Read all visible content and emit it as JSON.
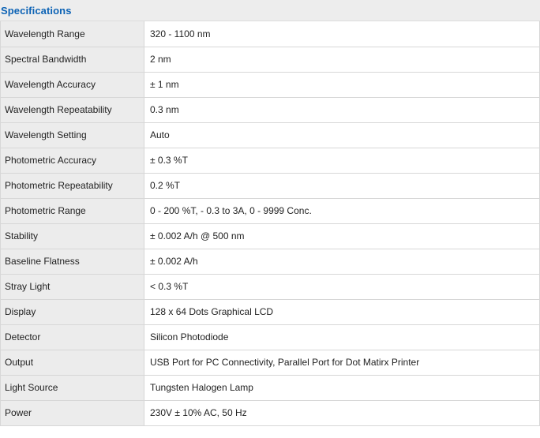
{
  "section": {
    "title": "Specifications"
  },
  "specs": [
    {
      "label": "Wavelength Range",
      "value": "320 - 1100 nm"
    },
    {
      "label": "Spectral Bandwidth",
      "value": "2 nm"
    },
    {
      "label": "Wavelength Accuracy",
      "value": "± 1 nm"
    },
    {
      "label": "Wavelength Repeatability",
      "value": "0.3 nm"
    },
    {
      "label": "Wavelength Setting",
      "value": "Auto"
    },
    {
      "label": "Photometric Accuracy",
      "value": "± 0.3 %T"
    },
    {
      "label": "Photometric Repeatability",
      "value": "0.2 %T"
    },
    {
      "label": "Photometric Range",
      "value": "0 - 200 %T, - 0.3 to 3A, 0 - 9999 Conc."
    },
    {
      "label": "Stability",
      "value": "± 0.002 A/h @ 500 nm"
    },
    {
      "label": "Baseline Flatness",
      "value": "± 0.002 A/h"
    },
    {
      "label": "Stray Light",
      "value": "< 0.3 %T"
    },
    {
      "label": "Display",
      "value": "128 x 64 Dots Graphical LCD"
    },
    {
      "label": "Detector",
      "value": "Silicon Photodiode"
    },
    {
      "label": "Output",
      "value": "USB Port for PC Connectivity, Parallel Port for Dot Matirx Printer"
    },
    {
      "label": "Light Source",
      "value": "Tungsten Halogen Lamp"
    },
    {
      "label": "Power",
      "value": "230V ± 10% AC, 50 Hz"
    }
  ],
  "colors": {
    "title": "#0d63b5",
    "label_background": "#ececec",
    "value_background": "#ffffff",
    "border": "#d7d7d7"
  }
}
